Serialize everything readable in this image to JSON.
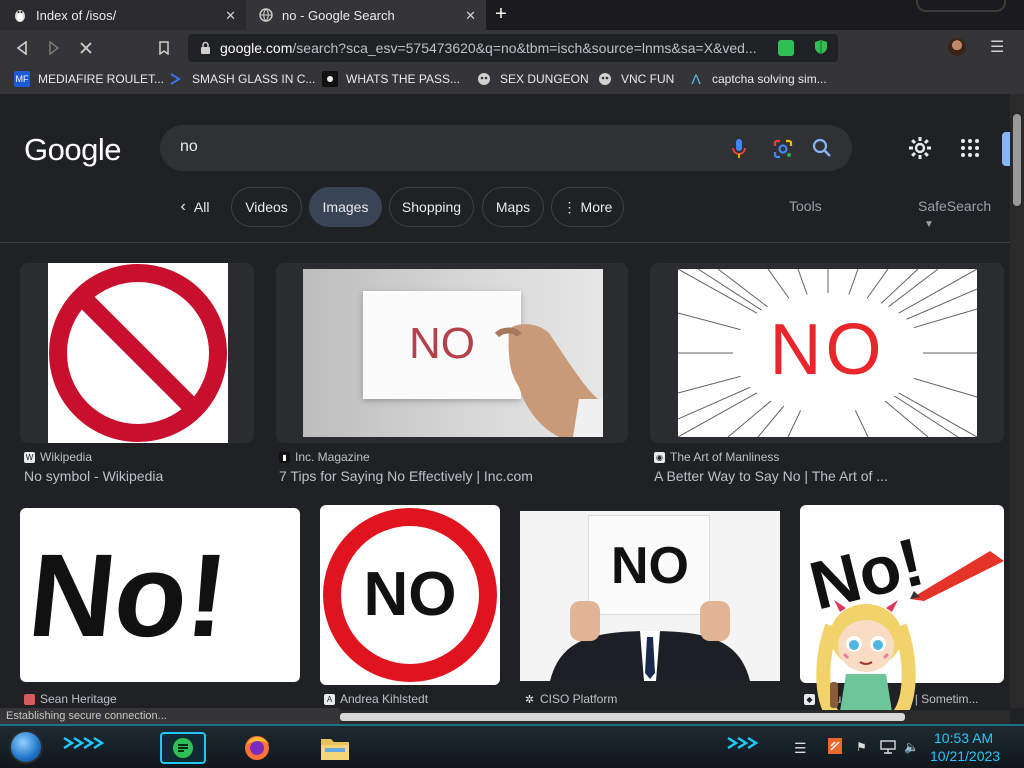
{
  "tabs": [
    {
      "title": "Index of /isos/",
      "close": "✕"
    },
    {
      "title": "no - Google Search",
      "close": "✕"
    }
  ],
  "new_tab": "+",
  "address_bar": {
    "domain": "google.com",
    "path": "/search?sca_esv=575473620&q=no&tbm=isch&source=lnms&sa=X&ved..."
  },
  "bookmarks": [
    {
      "label": "MEDIAFIRE ROULET...",
      "icon": "mediafire-icon"
    },
    {
      "label": "SMASH GLASS IN C...",
      "icon": "chevron-icon"
    },
    {
      "label": "WHATS THE PASS...",
      "icon": "shield-icon"
    },
    {
      "label": "SEX DUNGEON",
      "icon": "robot-icon"
    },
    {
      "label": "VNC FUN",
      "icon": "robot-icon"
    },
    {
      "label": "captcha solving sim...",
      "icon": "lambda-icon"
    }
  ],
  "google": {
    "logo": "Google",
    "query": "no",
    "chips": [
      "All",
      "Videos",
      "Images",
      "Shopping",
      "Maps",
      "More"
    ],
    "active_chip": "Images",
    "tools": "Tools",
    "safesearch": "SafeSearch"
  },
  "results": [
    {
      "source": "Wikipedia",
      "title": "No symbol - Wikipedia",
      "image_text": ""
    },
    {
      "source": "Inc. Magazine",
      "title": "7 Tips for Saying No Effectively | Inc.com",
      "image_text": "NO"
    },
    {
      "source": "The Art of Manliness",
      "title": "A Better Way to Say No | The Art of ...",
      "image_text": "NO"
    },
    {
      "source": "Sean Heritage",
      "title": "",
      "image_text": "No!"
    },
    {
      "source": "Andrea Kihlstedt",
      "title": "",
      "image_text": "NO"
    },
    {
      "source": "CISO Platform",
      "title": "",
      "image_text": "NO"
    },
    {
      "source": "Sau",
      "source_tail": "rk | Sometim...",
      "title": "",
      "image_text": "No!"
    }
  ],
  "status": "Establishing secure connection...",
  "clock": {
    "time": "10:53 AM",
    "date": "10/21/2023"
  },
  "colors": {
    "accent_blue": "#8ab4f8",
    "chip_active": "#394457",
    "no_red": "#c8102e",
    "clock": "#1ec8ff"
  }
}
